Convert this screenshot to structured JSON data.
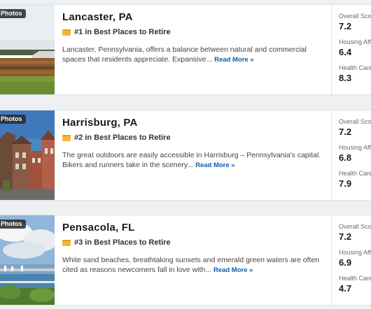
{
  "listings": [
    {
      "photos_badge": "Photos",
      "title": "Lancaster, PA",
      "rank_text": "#1 in Best Places to Retire",
      "description": "Lancaster, Pennsylvania, offers a balance between natural and commercial spaces that residents appreciate. Expansive...",
      "read_more": "Read More »",
      "scores": [
        {
          "label": "Overall Score",
          "value": "7.2"
        },
        {
          "label": "Housing Affordability",
          "value": "6.4"
        },
        {
          "label": "Health Care",
          "value": "8.3"
        }
      ]
    },
    {
      "photos_badge": "Photos",
      "title": "Harrisburg, PA",
      "rank_text": "#2 in Best Places to Retire",
      "description": "The great outdoors are easily accessible in Harrisburg – Pennsylvania's capital. Bikers and runners take in the scenery...",
      "read_more": "Read More »",
      "scores": [
        {
          "label": "Overall Score",
          "value": "7.2"
        },
        {
          "label": "Housing Affordability",
          "value": "6.8"
        },
        {
          "label": "Health Care",
          "value": "7.9"
        }
      ]
    },
    {
      "photos_badge": "Photos",
      "title": "Pensacola, FL",
      "rank_text": "#3 in Best Places to Retire",
      "description": "White sand beaches, breathtaking sunsets and emerald green waters are often cited as reasons newcomers fall in love with...",
      "read_more": "Read More »",
      "scores": [
        {
          "label": "Overall Score",
          "value": "7.2"
        },
        {
          "label": "Housing Affordability",
          "value": "6.9"
        },
        {
          "label": "Health Care",
          "value": "4.7"
        }
      ]
    }
  ],
  "colors": {
    "link": "#0f5ba7",
    "rank_icon": "#f2b834"
  },
  "icons": {
    "rank": "ribbon-icon"
  }
}
